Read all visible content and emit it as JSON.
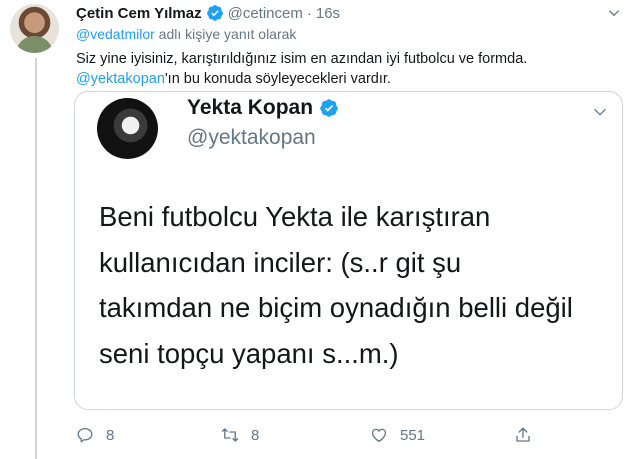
{
  "tweet": {
    "author_name": "Çetin Cem Yılmaz",
    "author_handle": "@cetincem",
    "separator": "·",
    "time": "16s",
    "reply_prefix": "@vedatmilor",
    "reply_suffix": " adlı kişiye yanıt olarak",
    "text_line1": "Siz yine iyisiniz, karıştırıldığınız isim en azından iyi futbolcu ve formda.",
    "text_line2_mention": "@yektakopan",
    "text_line2_rest": "'ın bu konuda söyleyecekleri vardır.",
    "colors": {
      "link": "#1da1f2",
      "verified": "#1da1f2",
      "muted": "#657786"
    }
  },
  "quoted": {
    "author_name": "Yekta Kopan",
    "author_handle": "@yektakopan",
    "lines": [
      "Beni futbolcu Yekta ile karıştıran",
      "kullanıcıdan inciler: (s..r git şu",
      "takımdan ne biçim oynadığın belli değil",
      "seni topçu yapanı s...m.)"
    ]
  },
  "actions": {
    "reply_icon": "reply-icon",
    "reply_count": "8",
    "retweet_icon": "retweet-icon",
    "retweet_count": "8",
    "like_icon": "heart-icon",
    "like_count": "551",
    "share_icon": "share-icon"
  }
}
